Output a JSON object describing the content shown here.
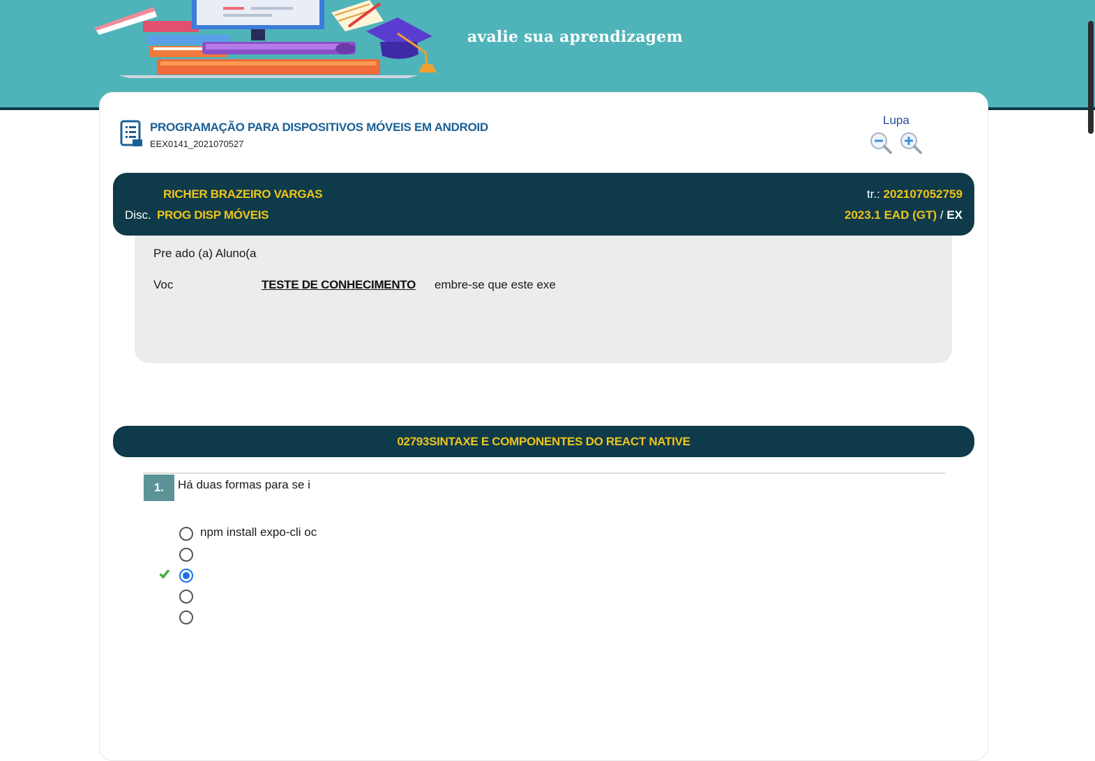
{
  "banner": {
    "tagline": "avalie sua aprendizagem"
  },
  "course": {
    "title": "PROGRAMAÇÃO PARA DISPOSITIVOS MÓVEIS EM ANDROID",
    "code": "EEX0141_2021070527"
  },
  "lupa": {
    "label": "Lupa"
  },
  "student": {
    "name": "RICHER BRAZEIRO VARGAS",
    "disc_label": "Disc.",
    "disc_value": "PROG DISP MÓVEIS",
    "matr_label": "tr.:",
    "matr_value": "202107052759",
    "period": "2023.1 EAD (GT)",
    "period_sep": " / ",
    "period_type": "EX"
  },
  "notice": {
    "greeting": "Pre  ado (a) Aluno(a",
    "voc": "Voc",
    "link": "TESTE DE CONHECIMENTO",
    "rest": "embre-se que este exe"
  },
  "section": {
    "title": "02793SINTAXE E COMPONENTES DO REACT NATIVE"
  },
  "question": {
    "number": "1.",
    "text": "Há duas formas para se i",
    "options": [
      {
        "label": "npm install expo-cli  oc",
        "selected": false
      },
      {
        "label": "",
        "selected": false
      },
      {
        "label": "",
        "selected": true
      },
      {
        "label": "",
        "selected": false
      },
      {
        "label": "",
        "selected": false
      }
    ]
  },
  "colors": {
    "banner": "#4fb4b9",
    "navy": "#0e3a4a",
    "gold": "#f0c419",
    "course_blue": "#1a5f94",
    "radio_selected": "#1a73e8",
    "check_green": "#3cc33c"
  }
}
